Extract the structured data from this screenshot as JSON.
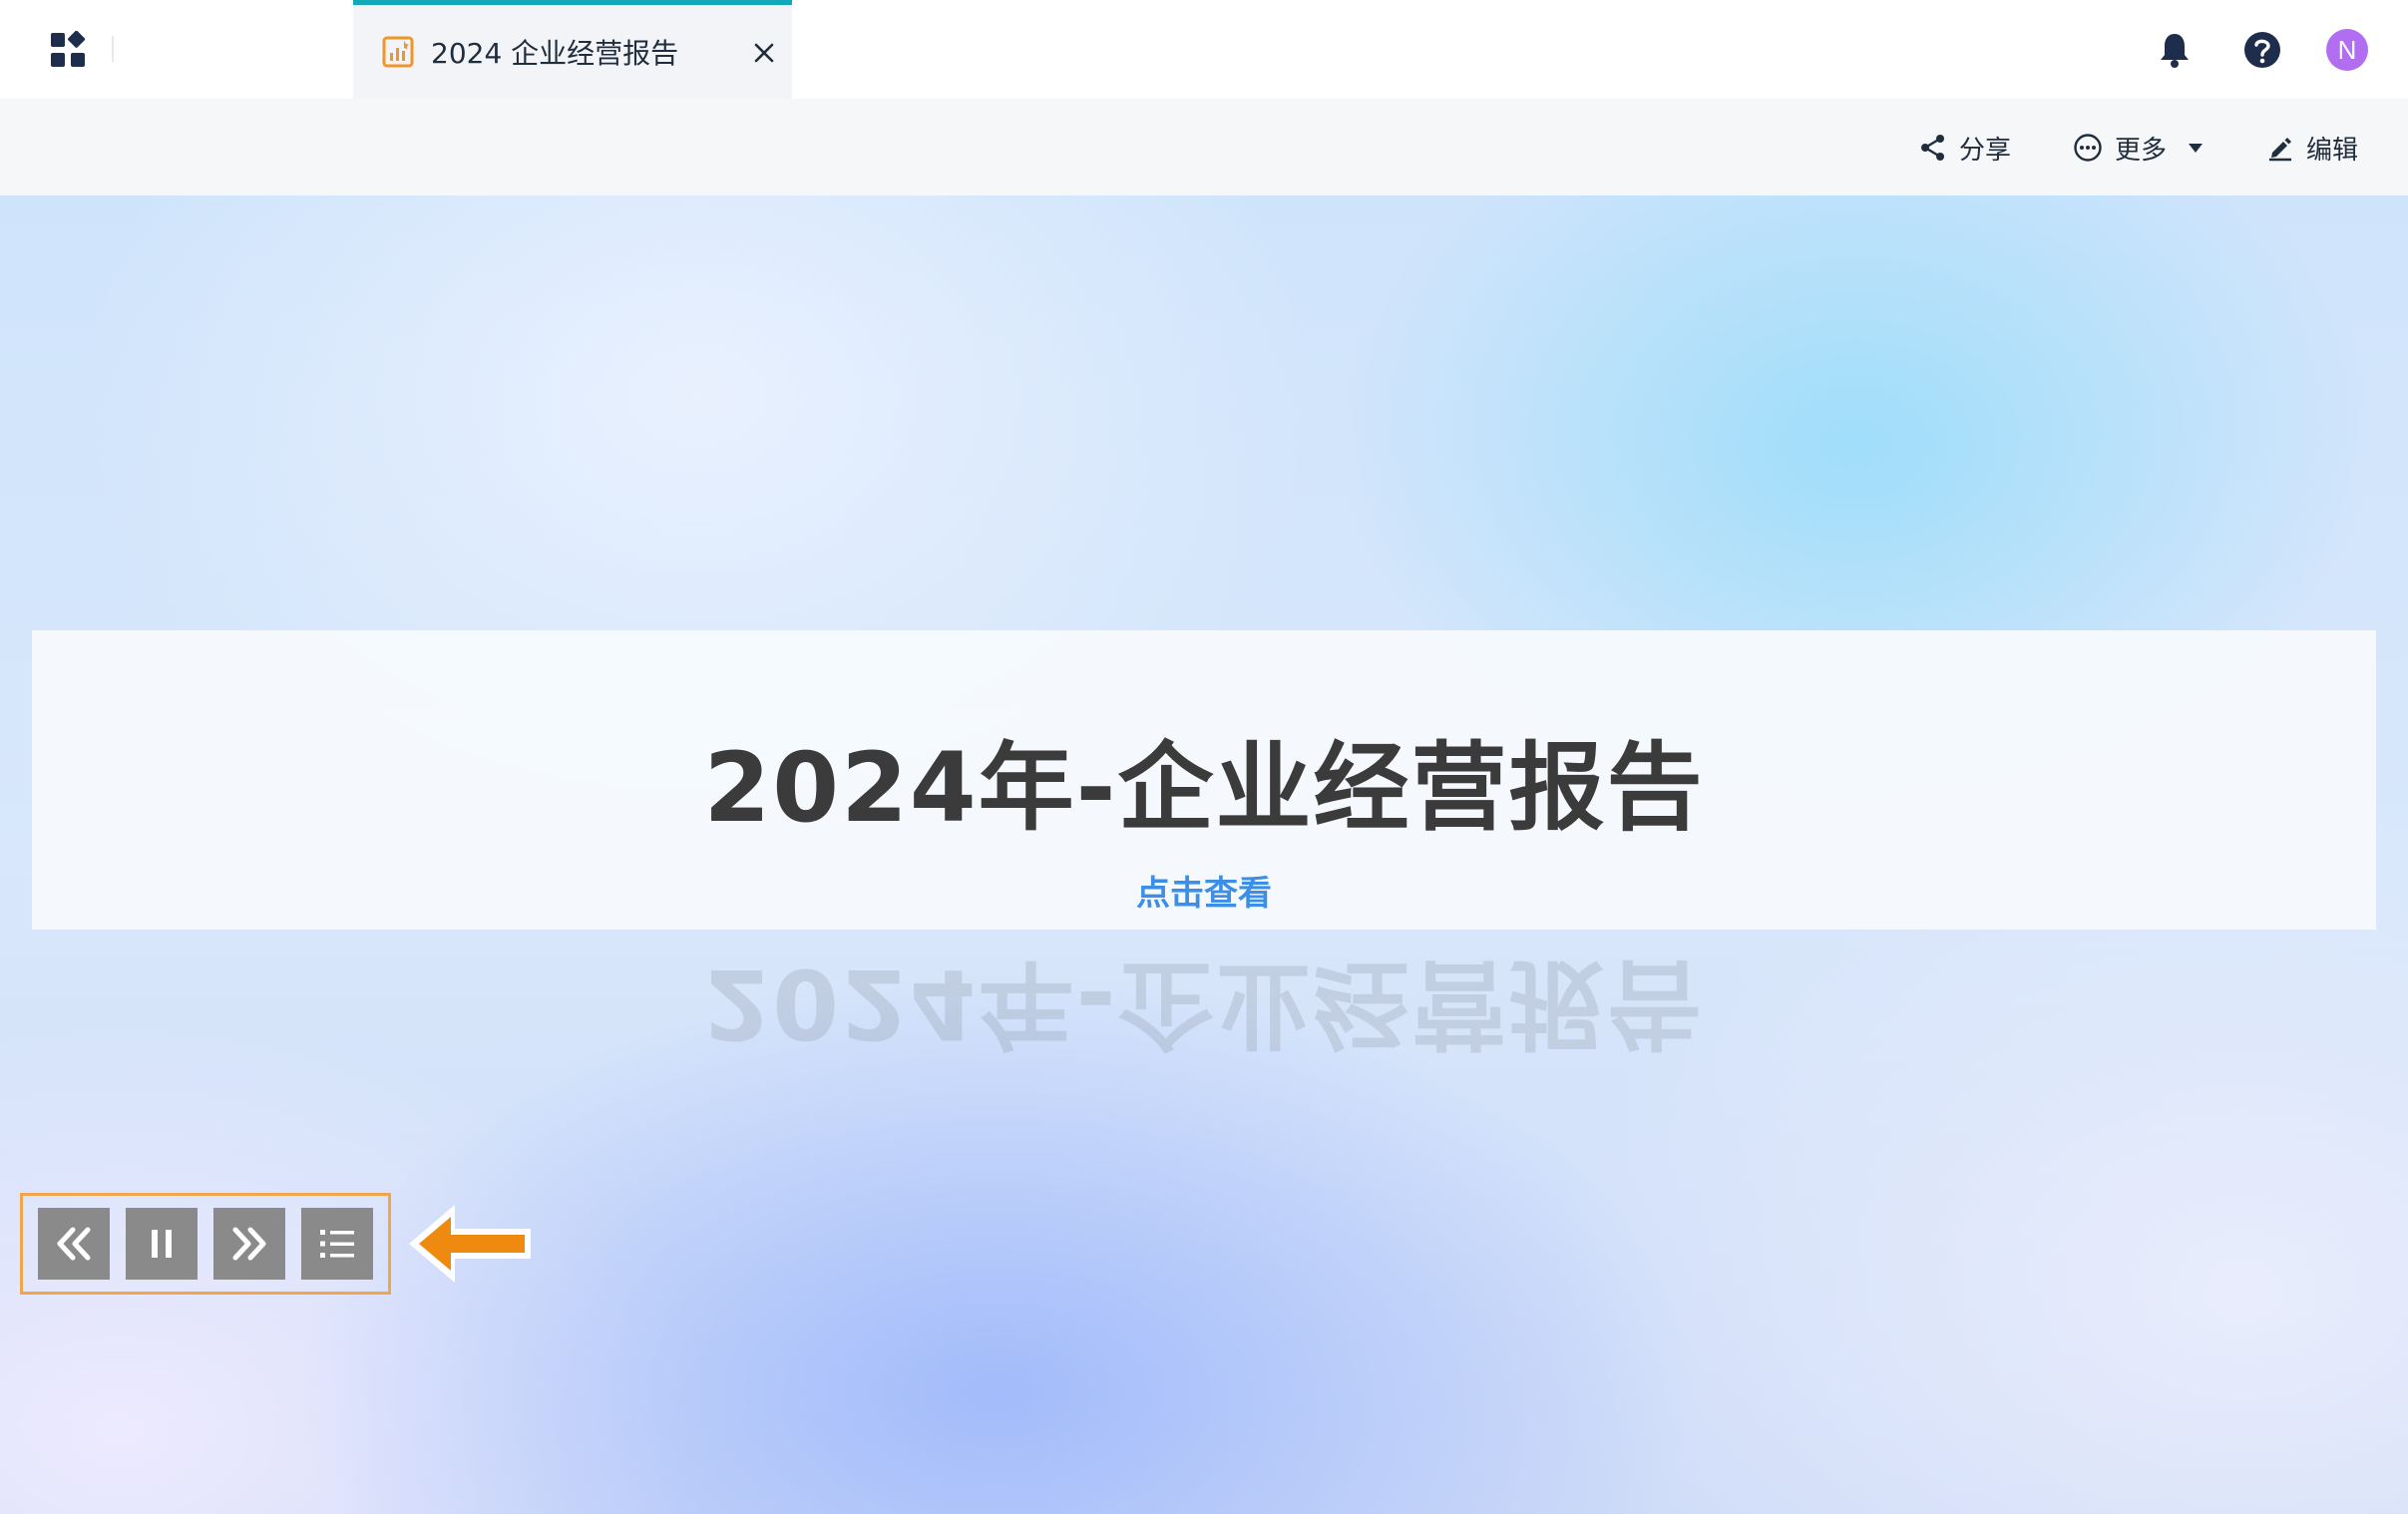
{
  "header": {
    "apps_icon": "apps-grid-icon",
    "tab": {
      "title": "2024 企业经营报告",
      "icon": "report-chart-icon",
      "accent": "#13a8b8"
    },
    "notifications_icon": "bell-icon",
    "help_icon": "question-circle-icon",
    "avatar": {
      "initial": "N",
      "color": "#b26ef0"
    }
  },
  "toolbar": {
    "share_label": "分享",
    "more_label": "更多",
    "edit_label": "编辑"
  },
  "slide": {
    "title": "2024年-企业经营报告",
    "link_label": "点击查看",
    "link_color": "#3d8fe6"
  },
  "playback": {
    "prev_icon": "double-chevron-left-icon",
    "pause_icon": "pause-icon",
    "next_icon": "double-chevron-right-icon",
    "catalog_icon": "list-icon",
    "highlight_color": "#f0a64a"
  }
}
